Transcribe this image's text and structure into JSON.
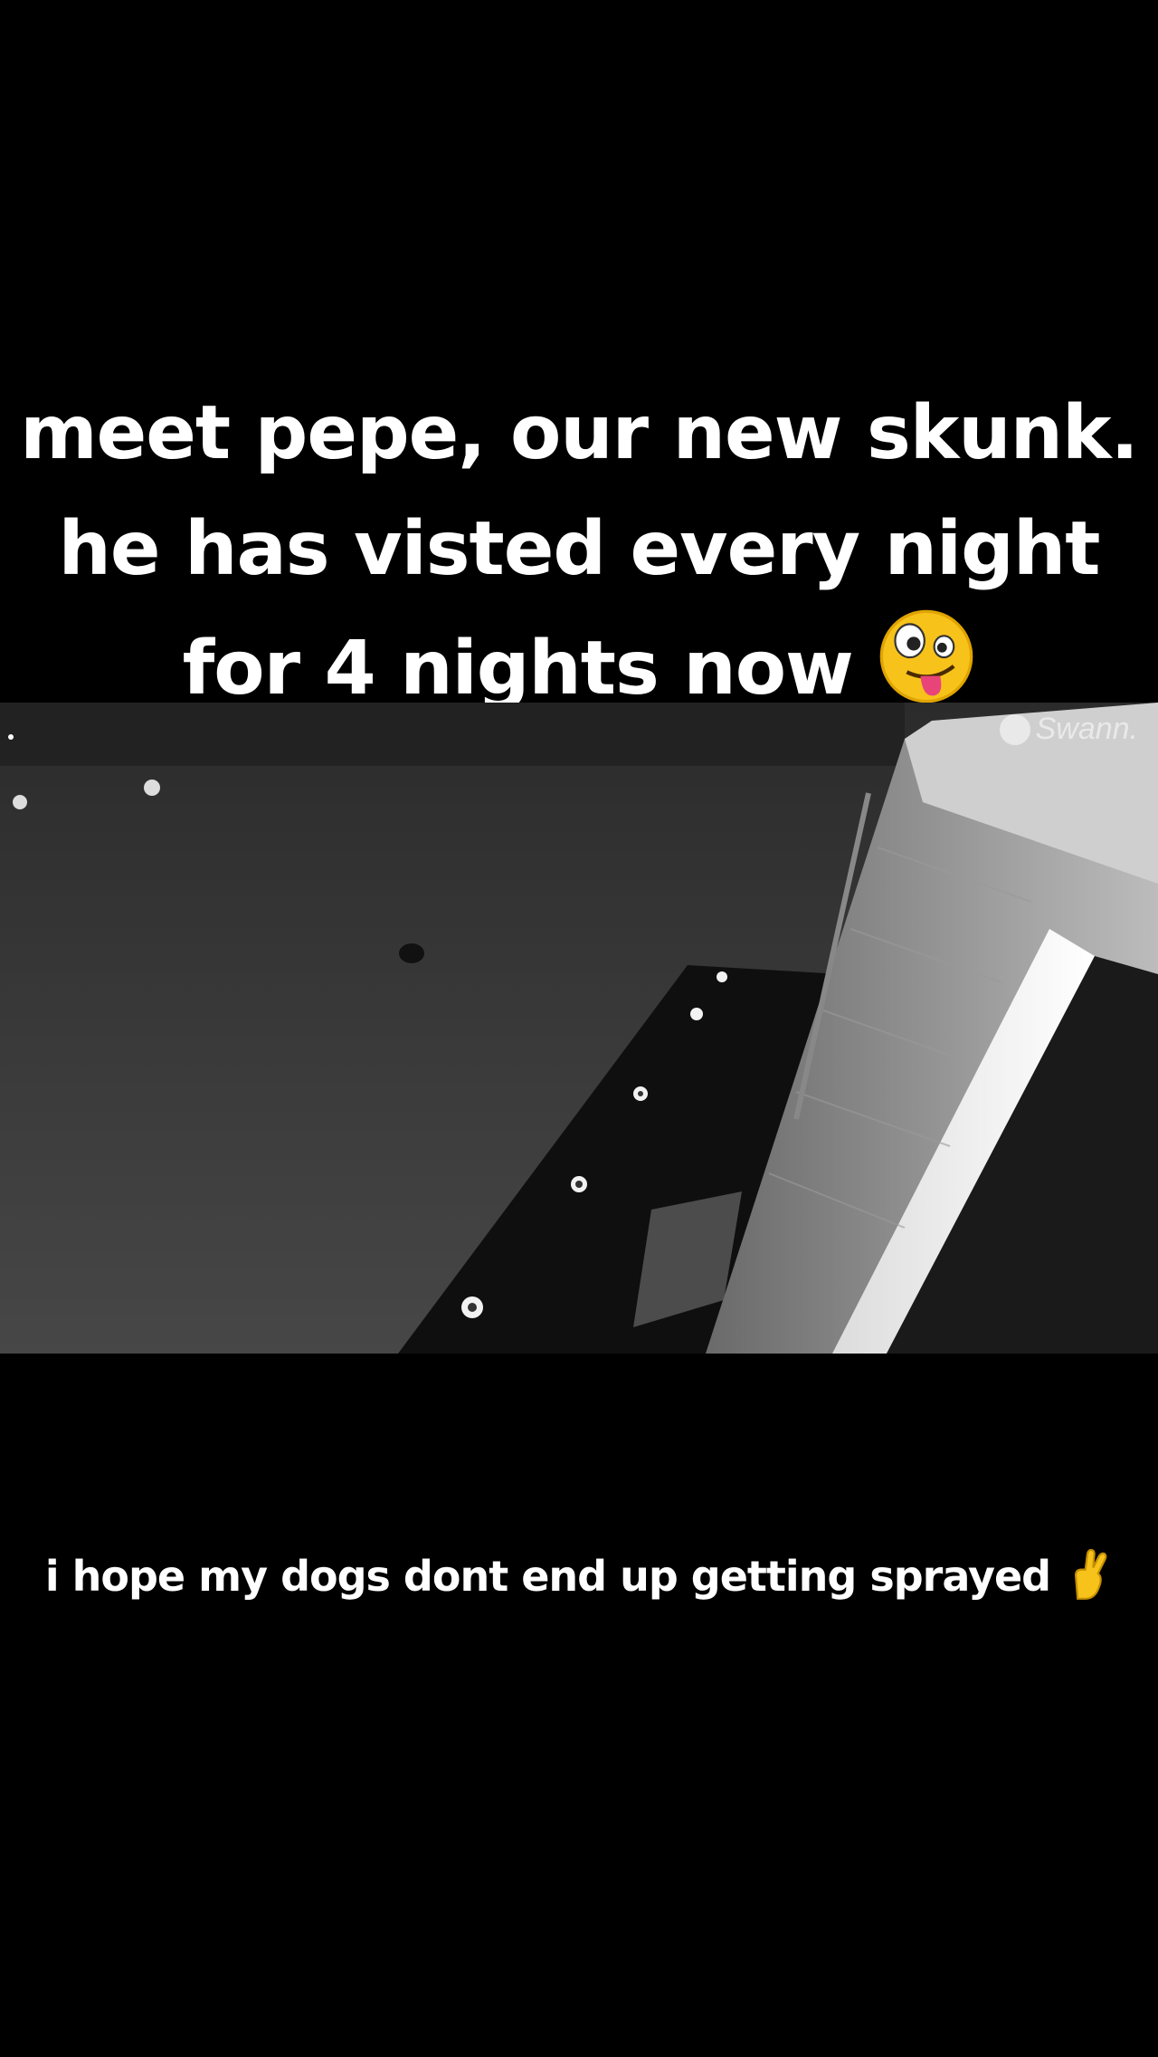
{
  "overlay_caption": {
    "line1": "meet pepe, our new skunk.",
    "line2": "he has visted every night",
    "line3": "for 4 nights now",
    "emoji_icon": "zany-face-emoji-icon"
  },
  "video": {
    "watermark": "Swann."
  },
  "bottom_caption": {
    "text": "i hope my dogs dont end up getting sprayed",
    "emoji_icon": "crossed-fingers-emoji-icon"
  }
}
